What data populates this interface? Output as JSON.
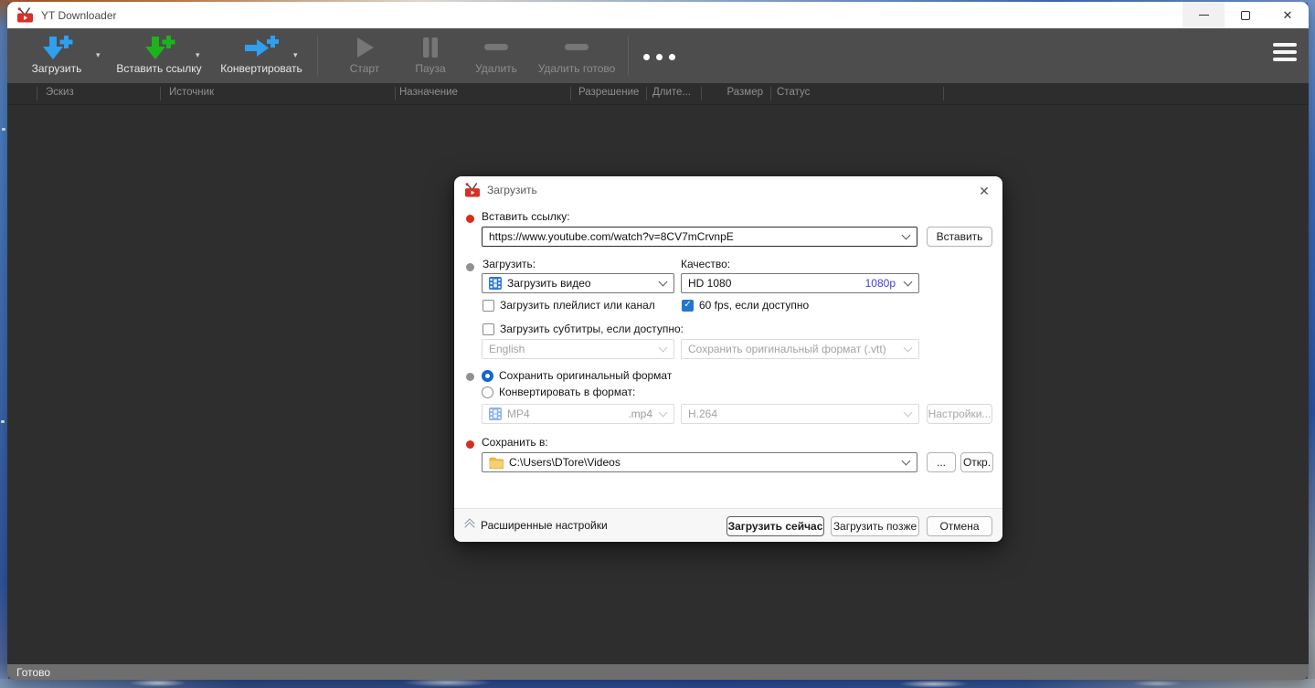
{
  "window": {
    "title": "YT Downloader"
  },
  "toolbar": {
    "buttons": [
      {
        "label": "Загрузить",
        "icon": "download-plus-icon",
        "enabled": true
      },
      {
        "label": "Вставить ссылку",
        "icon": "paste-link-icon",
        "enabled": true
      },
      {
        "label": "Конвертировать",
        "icon": "convert-plus-icon",
        "enabled": true
      },
      {
        "label": "Старт",
        "icon": "play-icon",
        "enabled": false
      },
      {
        "label": "Пауза",
        "icon": "pause-icon",
        "enabled": false
      },
      {
        "label": "Удалить",
        "icon": "remove-icon",
        "enabled": false
      },
      {
        "label": "Удалить готово",
        "icon": "remove-completed-icon",
        "enabled": false
      }
    ]
  },
  "table": {
    "columns": [
      "Эскиз",
      "Источник",
      "Назначение",
      "Разрешение",
      "Длите...",
      "Размер",
      "Статус"
    ]
  },
  "dialog": {
    "title": "Загрузить",
    "link_label": "Вставить ссылку:",
    "url_value": "https://www.youtube.com/watch?v=8CV7mCrvnpE",
    "paste_button": "Вставить",
    "download_label": "Загрузить:",
    "download_value": "Загрузить видео",
    "quality_label": "Качество:",
    "quality_value": "HD 1080",
    "quality_badge": "1080p",
    "playlist_checkbox": "Загрузить плейлист или канал",
    "fps_checkbox": "60 fps, если доступно",
    "subtitles_checkbox": "Загрузить субтитры, если доступно:",
    "subtitles_language": "English",
    "subtitles_format": "Сохранить оригинальный формат (.vtt)",
    "radio_original": "Сохранить оригинальный формат",
    "radio_convert": "Конвертировать в формат:",
    "format_value": "MP4",
    "format_ext": ".mp4",
    "codec_value": "H.264",
    "settings_button": "Настройки...",
    "save_label": "Сохранить в:",
    "save_path": "C:\\Users\\DTore\\Videos",
    "browse_button": "...",
    "open_button": "Откр.",
    "advanced_label": "Расширенные настройки",
    "download_now_button": "Загрузить сейчас",
    "download_later_button": "Загрузить позже",
    "cancel_button": "Отмена"
  },
  "statusbar": {
    "text": "Готово"
  },
  "icons": {
    "check": "✓",
    "dropdown_triangle": "▾",
    "app_logo": "red-tv-icon",
    "film": "film-strip-icon",
    "folder": "folder-icon"
  },
  "colors": {
    "accent_blue": "#2da0f0",
    "accent_green": "#1db31d",
    "toolbar_bg": "#4d4d4d",
    "content_bg": "#2e2e2e",
    "statusbar_bg": "#6e6e6e",
    "checkbox_blue": "#2176d2",
    "radio_blue": "#1166cf",
    "quality_badge_blue": "#4040d8",
    "required_bullet_red": "#da2b1b",
    "optional_bullet_gray": "#909090"
  }
}
